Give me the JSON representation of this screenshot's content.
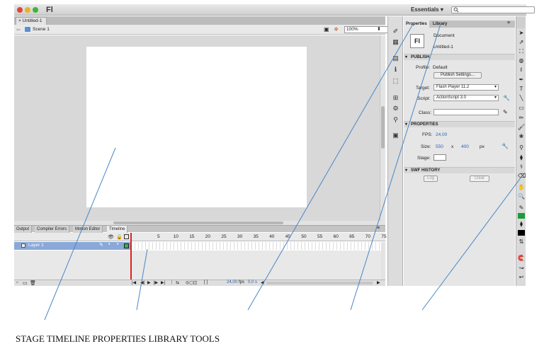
{
  "window": {
    "app_name": "Fl",
    "workspace": "Essentials",
    "workspace_caret": "▾",
    "search_icon": "search-icon"
  },
  "document": {
    "tab_label": "Untitled-1",
    "tab_close": "×",
    "scene": "Scene 1",
    "zoom": "100%"
  },
  "timeline": {
    "tabs": [
      "Output",
      "Compiler Errors",
      "Motion Editor",
      "Timeline"
    ],
    "active_tab": "Timeline",
    "frame_numbers": [
      "5",
      "10",
      "15",
      "20",
      "25",
      "30",
      "35",
      "40",
      "45",
      "50",
      "55",
      "60",
      "65",
      "70",
      "75"
    ],
    "layer_name": "Layer 1",
    "fps_readout": "24,00",
    "fps_unit": "fps",
    "time_readout": "0,0 s"
  },
  "properties_panel": {
    "tabs": [
      "Properties",
      "Library"
    ],
    "doc_type_icon": "Fl",
    "doc_type": "Document",
    "doc_name": "Untitled-1",
    "publish": {
      "header": "PUBLISH",
      "profile_label": "Profile:",
      "profile_value": "Default",
      "publish_settings_button": "Publish Settings...",
      "target_label": "Target:",
      "target_value": "Flash Player 11.2",
      "script_label": "Script:",
      "script_value": "ActionScript 3.0",
      "class_label": "Class:"
    },
    "properties": {
      "header": "PROPERTIES",
      "fps_label": "FPS:",
      "fps_value": "24,00",
      "size_label": "Size:",
      "width": "550",
      "times": "x",
      "height": "400",
      "unit": "px",
      "stage_label": "Stage:"
    },
    "swf_history": {
      "header": "SWF HISTORY",
      "log_button": "Log",
      "clear_button": "Clear"
    }
  },
  "tools": [
    "selection-tool",
    "subselection-tool",
    "free-transform-tool",
    "3d-rotation-tool",
    "lasso-tool",
    "pen-tool",
    "text-tool",
    "line-tool",
    "rectangle-tool",
    "pencil-tool",
    "brush-tool",
    "deco-tool",
    "bone-tool",
    "paint-bucket-tool",
    "eyedropper-tool",
    "eraser-tool",
    "hand-tool",
    "zoom-tool",
    "stroke-color",
    "fill-color"
  ],
  "colors": {
    "stroke_swatch": "#1a9c3a",
    "fill_swatch": "#000000",
    "callout_line": "#4a86c6",
    "layer_highlight": "#8aa8d8"
  },
  "caption": {
    "text": "STAGE TIMELINE PROPERTIES LIBRARY TOOLS"
  }
}
